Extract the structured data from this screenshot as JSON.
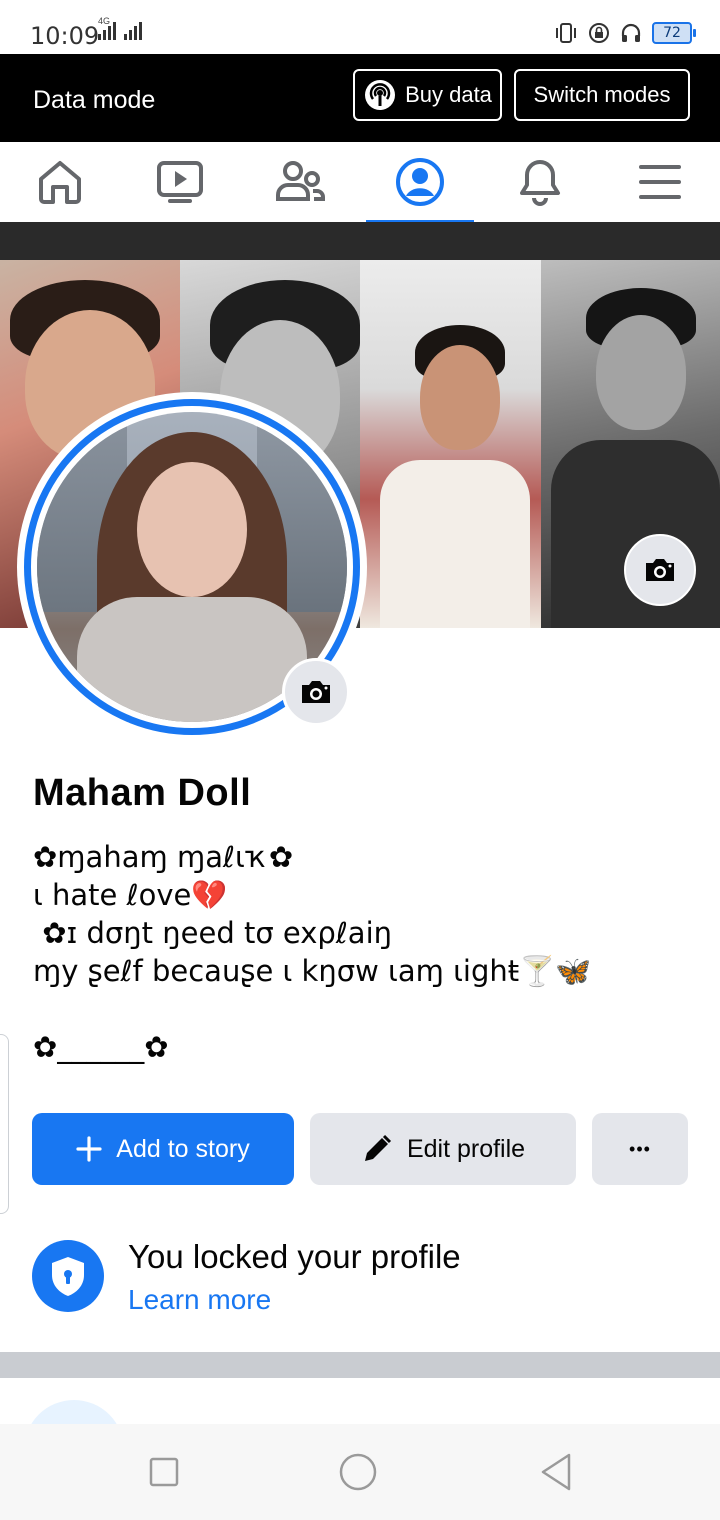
{
  "status_bar": {
    "time": "10:09",
    "network_type": "4G",
    "battery": "72"
  },
  "data_bar": {
    "title": "Data mode",
    "buy_label": "Buy data",
    "switch_label": "Switch modes"
  },
  "nav": {
    "items": [
      "home",
      "watch",
      "friends",
      "profile",
      "notifications",
      "menu"
    ],
    "active": "profile",
    "accent": "#1877f2"
  },
  "profile": {
    "name": "Maham Doll",
    "bio": [
      "✿ɱahaɱ ɱaℓɩҡ✿",
      "ɩ hate ℓove💔",
      " ✿ɪ dσŋt ŋeed tσ exρℓaiŋ",
      "ɱy ʂeℓf becauʂe ɩ kŋσw ɩaɱ ɩighŧ🍸🦋",
      "",
      "✿______✿"
    ]
  },
  "actions": {
    "add_story": "Add to story",
    "edit_profile": "Edit profile",
    "more": "•••"
  },
  "lock_notice": {
    "title": "You locked your profile",
    "link": "Learn more"
  },
  "icons": {
    "cover_camera": "camera-icon",
    "avatar_camera": "camera-icon",
    "lock": "shield-lock-icon"
  }
}
